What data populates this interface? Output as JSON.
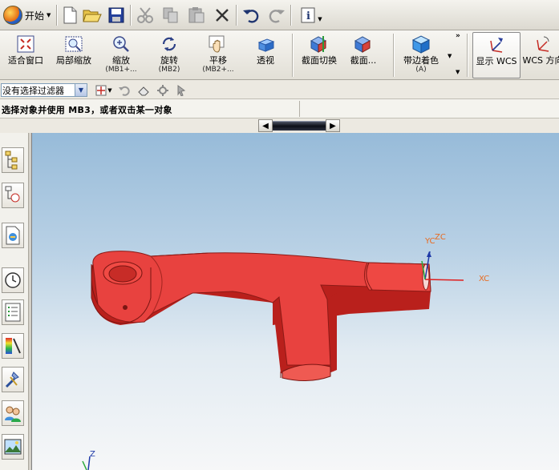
{
  "app": {
    "start_label": "开始"
  },
  "ribbon": {
    "fit": {
      "label": "适合窗口"
    },
    "zoom_region": {
      "label": "局部缩放"
    },
    "zoom": {
      "label": "缩放",
      "sub": "(MB1+..."
    },
    "rotate": {
      "label": "旋转",
      "sub": "(MB2)"
    },
    "pan": {
      "label": "平移",
      "sub": "(MB2+..."
    },
    "perspective": {
      "label": "透视"
    },
    "section_toggle": {
      "label": "截面切换"
    },
    "section": {
      "label": "截面..."
    },
    "shaded_edges": {
      "label": "带边着色",
      "sub": "(A)"
    },
    "display_wcs": {
      "label": "显示 WCS"
    },
    "wcs_orient": {
      "label": "WCS 方向"
    }
  },
  "filter": {
    "value": "没有选择过滤器"
  },
  "status": {
    "prompt": "选择对象并使用 MB3，或者双击某一对象"
  },
  "viewport": {
    "axis_labels": {
      "x": "XC",
      "y": "YC",
      "z": "ZC",
      "abs_z": "Z"
    },
    "model_color": "#e8423f",
    "axis_color": "#e86a1f"
  },
  "icons": {
    "new": "new-file-icon",
    "open": "open-folder-icon",
    "save": "save-icon",
    "cut": "cut-icon",
    "copy": "copy-icon",
    "paste": "paste-icon",
    "delete": "delete-icon",
    "undo": "undo-icon",
    "redo": "redo-icon",
    "info": "info-icon"
  }
}
